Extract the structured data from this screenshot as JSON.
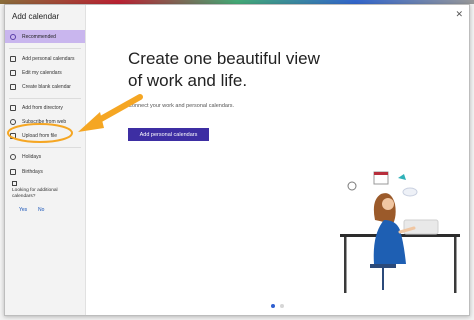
{
  "dialog": {
    "title": "Add calendar",
    "close_glyph": "✕"
  },
  "sidebar": {
    "items": [
      {
        "label": "Recommended",
        "icon": "lightbulb-icon",
        "selected": true
      },
      {
        "label": "Add personal calendars",
        "icon": "calendar-add-icon"
      },
      {
        "label": "Edit my calendars",
        "icon": "calendar-edit-icon"
      },
      {
        "label": "Create blank calendar",
        "icon": "calendar-icon"
      },
      {
        "label": "Add from directory",
        "icon": "directory-icon"
      },
      {
        "label": "Subscribe from web",
        "icon": "globe-icon"
      },
      {
        "label": "Upload from file",
        "icon": "upload-icon"
      },
      {
        "label": "Holidays",
        "icon": "holiday-icon"
      },
      {
        "label": "Birthdays",
        "icon": "birthday-icon"
      }
    ],
    "feedback": {
      "question": "Looking for additional calendars?",
      "yes": "Yes",
      "no": "No"
    }
  },
  "main": {
    "headline": "Create one beautiful view of work and life.",
    "subline": "Connect your work and personal calendars.",
    "cta_label": "Add personal calendars",
    "pager": {
      "count": 2,
      "active_index": 1
    }
  },
  "colors": {
    "accent": "#3d2ea3",
    "selected_bg": "#c9b6ee",
    "arrow": "#f5a623",
    "link": "#1a55b8"
  }
}
